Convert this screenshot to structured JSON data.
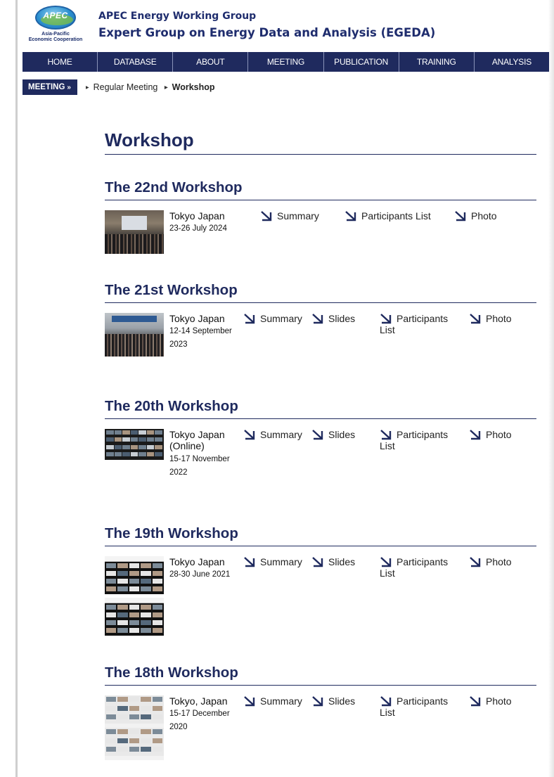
{
  "header": {
    "logo_text": "APEC",
    "logo_sub_1": "Asia-Pacific",
    "logo_sub_2": "Economic Cooperation",
    "org_line1": "APEC Energy Working Group",
    "org_line2": "Expert Group on Energy Data and Analysis (EGEDA)"
  },
  "nav": {
    "items": [
      "HOME",
      "DATABASE",
      "ABOUT",
      "MEETING",
      "PUBLICATION",
      "TRAINING",
      "ANALYSIS"
    ]
  },
  "breadcrumb": {
    "section": "MEETING",
    "section_sep": "»",
    "items": [
      "Regular Meeting",
      "Workshop"
    ]
  },
  "page": {
    "title": "Workshop"
  },
  "workshops": [
    {
      "title": "The 22nd Workshop",
      "place": "Tokyo Japan",
      "date": "23-26 July 2024",
      "links": [
        "Summary",
        "Participants List",
        "Photo"
      ]
    },
    {
      "title": "The 21st Workshop",
      "place": "Tokyo Japan",
      "date": "12-14 September 2023",
      "links": [
        "Summary",
        "Slides",
        "Participants List",
        "Photo"
      ]
    },
    {
      "title": "The 20th Workshop",
      "place": "Tokyo Japan (Online)",
      "date": "15-17 November 2022",
      "links": [
        "Summary",
        "Slides",
        "Participants List",
        "Photo"
      ]
    },
    {
      "title": "The 19th Workshop",
      "place": "Tokyo Japan",
      "date": "28-30 June 2021",
      "links": [
        "Summary",
        "Slides",
        "Participants List",
        "Photo"
      ]
    },
    {
      "title": "The 18th Workshop",
      "place": "Tokyo, Japan",
      "date": "15-17 December 2020",
      "links": [
        "Summary",
        "Slides",
        "Participants List",
        "Photo"
      ]
    }
  ],
  "colors": {
    "navy": "#1f2a5e",
    "frame": "#cfcfcf"
  },
  "icons": {
    "link_arrow": "down-right-arrow-icon",
    "crumb_bullet": "triangle-right-icon"
  }
}
